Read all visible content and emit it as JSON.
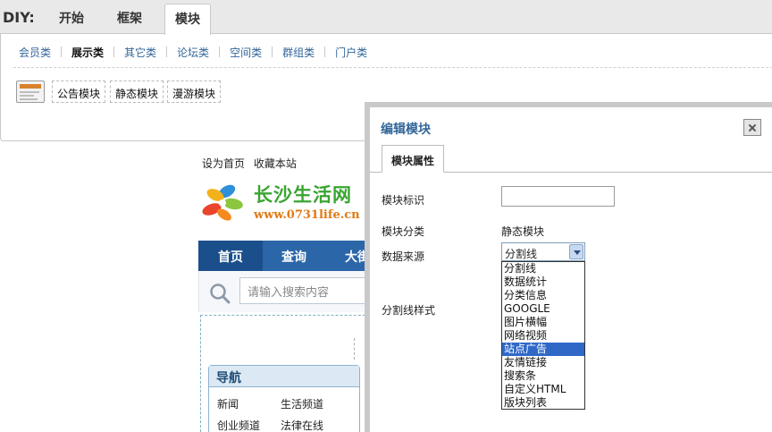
{
  "diy": {
    "label": "DIY:",
    "tabs": [
      "开始",
      "框架",
      "模块"
    ],
    "active_tab": "模块",
    "categories": [
      "会员类",
      "展示类",
      "其它类",
      "论坛类",
      "空间类",
      "群组类",
      "门户类"
    ],
    "active_category": "展示类",
    "modules": [
      "公告模块",
      "静态模块",
      "漫游模块"
    ]
  },
  "site": {
    "top_links": [
      "设为首页",
      "收藏本站"
    ],
    "logo_text": "长沙生活网",
    "logo_url": "www.0731life.cn",
    "nav": [
      "首页",
      "查询",
      "大街"
    ],
    "search_placeholder": "请输入搜索内容",
    "nav_box_title": "导航",
    "nav_links": [
      "新闻",
      "生活频道",
      "创业频道",
      "法律在线"
    ]
  },
  "dialog": {
    "title": "编辑模块",
    "tab": "模块属性",
    "fields": {
      "id_label": "模块标识",
      "id_value": "",
      "category_label": "模块分类",
      "category_value": "静态模块",
      "source_label": "数据来源",
      "source_selected": "分割线",
      "style_label": "分割线样式"
    },
    "source_options": [
      "分割线",
      "数据统计",
      "分类信息",
      "GOOGLE",
      "图片横幅",
      "网络视频",
      "站点广告",
      "友情链接",
      "搜索条",
      "自定义HTML",
      "版块列表"
    ],
    "highlighted_option": "站点广告"
  }
}
